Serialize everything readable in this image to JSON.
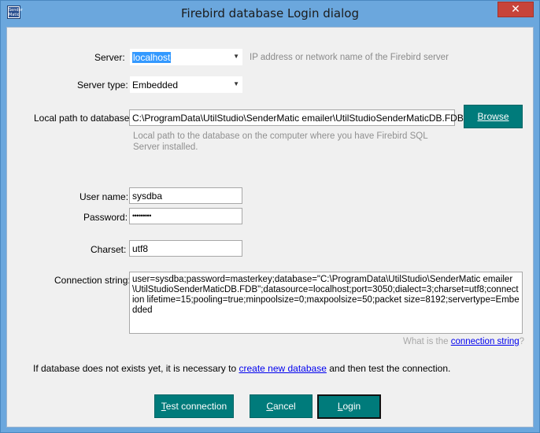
{
  "window": {
    "title": "Firebird database Login dialog",
    "icon_text": "Sender Matic",
    "close_glyph": "✕"
  },
  "server": {
    "label": "Server:",
    "value": "localhost",
    "hint": "IP address or network name of the Firebird server"
  },
  "server_type": {
    "label": "Server type:",
    "value": "Embedded"
  },
  "local_path": {
    "label": "Local path to database:",
    "value": "C:\\ProgramData\\UtilStudio\\SenderMatic emailer\\UtilStudioSenderMaticDB.FDB",
    "hint": "Local path to the database on the computer where you have Firebird SQL Server installed.",
    "browse_label": "Browse"
  },
  "username": {
    "label": "User name:",
    "value": "sysdba"
  },
  "password": {
    "label": "Password:",
    "value": "•••••••••"
  },
  "charset": {
    "label": "Charset:",
    "value": "utf8"
  },
  "connection_string": {
    "label": "Connection string:",
    "value": "user=sysdba;password=masterkey;database=\"C:\\ProgramData\\UtilStudio\\SenderMatic emailer\\UtilStudioSenderMaticDB.FDB\";datasource=localhost;port=3050;dialect=3;charset=utf8;connection lifetime=15;pooling=true;minpoolsize=0;maxpoolsize=50;packet size=8192;servertype=Embedded",
    "help_prefix": "What is the ",
    "help_link": "connection string",
    "help_suffix": "?"
  },
  "notice": {
    "prefix": "If database does not exists yet, it is necessary to ",
    "link": "create new database",
    "suffix": " and then test the connection."
  },
  "buttons": {
    "test_first": "T",
    "test_rest": "est connection",
    "cancel_first": "C",
    "cancel_rest": "ancel",
    "login_first": "L",
    "login_rest": "ogin"
  },
  "colors": {
    "button_bg": "#007b7b",
    "titlebar": "#6ba7dd",
    "close_button": "#c7443a",
    "link": "#0000ee"
  }
}
